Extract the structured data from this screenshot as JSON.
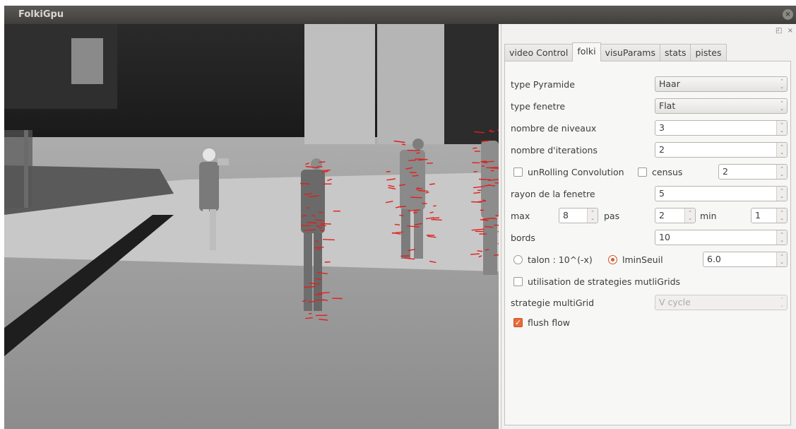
{
  "window": {
    "title": "FolkiGpu",
    "close_glyph": "×"
  },
  "dock": {
    "buttons": "◰ ×"
  },
  "tabs": [
    {
      "label": "video Control",
      "active": false
    },
    {
      "label": "folki",
      "active": true
    },
    {
      "label": "visuParams",
      "active": false
    },
    {
      "label": "stats",
      "active": false
    },
    {
      "label": "pistes",
      "active": false
    }
  ],
  "folki": {
    "type_pyramide": {
      "label": "type Pyramide",
      "value": "Haar"
    },
    "type_fenetre": {
      "label": "type fenetre",
      "value": "Flat"
    },
    "nombre_niveaux": {
      "label": "nombre de niveaux",
      "value": "3"
    },
    "nombre_iterations": {
      "label": "nombre d'iterations",
      "value": "2"
    },
    "unrolling": {
      "label": "unRolling Convolution",
      "checked": false
    },
    "census": {
      "label": "census",
      "checked": false,
      "value": "2"
    },
    "rayon_fenetre": {
      "label": "rayon de la fenetre",
      "value": "5"
    },
    "max": {
      "label": "max",
      "value": "8"
    },
    "pas": {
      "label": "pas",
      "value": "2"
    },
    "min": {
      "label": "min",
      "value": "1"
    },
    "bords": {
      "label": "bords",
      "value": "10"
    },
    "talon": {
      "label": "talon : 10^(-x)",
      "selected": false
    },
    "lmin_seuil": {
      "label": "lminSeuil",
      "selected": true,
      "value": "6.0"
    },
    "multigrid_use": {
      "label": "utilisation de strategies mutliGrids",
      "checked": false
    },
    "strategie_multigrid": {
      "label": "strategie multiGrid",
      "value": "V cycle",
      "disabled": true
    },
    "flush_flow": {
      "label": "flush flow",
      "checked": true
    }
  },
  "colors": {
    "accent": "#e96a39",
    "titlebar": "#3f3e3a",
    "flow_vectors": "#e0201c"
  },
  "icons": {
    "spin_arrows": "⌃⌄",
    "check_mark": "✓"
  }
}
